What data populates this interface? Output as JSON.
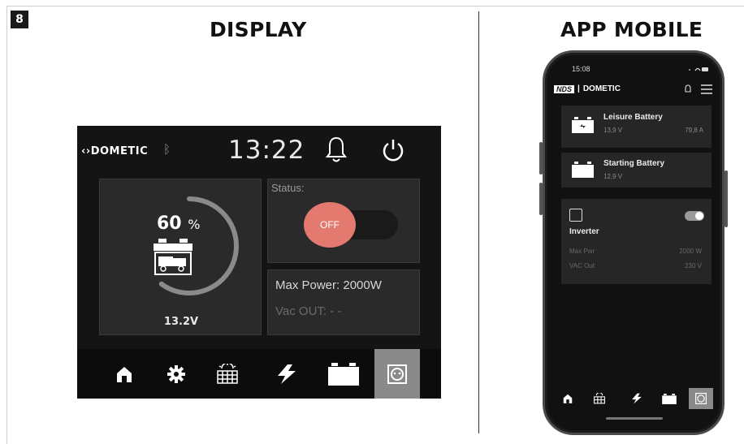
{
  "step_number": "8",
  "titles": {
    "display": "DISPLAY",
    "app": "APP MOBILE"
  },
  "display": {
    "brand": "DOMETIC",
    "time": "13:22",
    "battery": {
      "percent": "60",
      "percent_unit": "%",
      "voltage": "13.2V",
      "level": 0.6
    },
    "status_label": "Status:",
    "toggle_label": "OFF",
    "max_power": "Max Power: 2000W",
    "vac_out": "Vac OUT: - -",
    "nav_items": [
      "home-icon",
      "gear-icon",
      "solar-panel-icon",
      "charger-icon",
      "battery-icon",
      "socket-icon"
    ],
    "nav_active": "socket-icon"
  },
  "app": {
    "time": "15:08",
    "logo_nds": "NDS",
    "brand": "DOMETIC",
    "leisure": {
      "title": "Leisure Battery",
      "voltage": "13,9 V",
      "current": "79,8 A"
    },
    "starting": {
      "title": "Starting Battery",
      "voltage": "12,9 V"
    },
    "inverter": {
      "title": "Inverter",
      "max_power_label": "Max Pwr",
      "max_power_value": "2000 W",
      "vac_label": "VAC Out",
      "vac_value": "230 V",
      "enabled": true
    },
    "nav_items": [
      "home-icon",
      "solar-panel-icon",
      "charger-icon",
      "battery-icon",
      "socket-icon"
    ],
    "nav_active": "socket-icon"
  }
}
